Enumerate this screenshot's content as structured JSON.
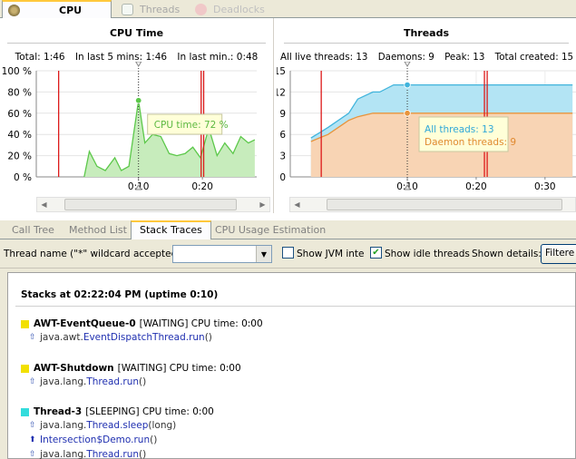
{
  "top_tabs": [
    {
      "label": "CPU",
      "icon": "cpu-icon",
      "active": true
    },
    {
      "label": "Threads",
      "icon": "threads-icon",
      "active": false
    },
    {
      "label": "Deadlocks",
      "icon": "deadlocks-icon",
      "active": false
    }
  ],
  "cpu_panel": {
    "title": "CPU Time",
    "stats": {
      "total": "Total: 1:46",
      "last5": "In last 5 mins: 1:46",
      "lastmin": "In last min.: 0:48"
    },
    "tooltip": "CPU time: 72 %"
  },
  "threads_panel": {
    "title": "Threads",
    "stats": {
      "live": "All live threads: 13",
      "daemons": "Daemons: 9",
      "peak": "Peak: 13",
      "created": "Total created: 15"
    },
    "tooltip_all": "All threads: 13",
    "tooltip_daemon": "Daemon threads: 9"
  },
  "chart_data": [
    {
      "type": "area",
      "title": "CPU Time",
      "xlabel": "",
      "ylabel": "",
      "yticks": [
        "100 %",
        "80 %",
        "60 %",
        "40 %",
        "20 %",
        "0 %"
      ],
      "xticks": [
        "0:10",
        "0:20"
      ],
      "ylim": [
        0,
        100
      ],
      "x_seconds": [
        1.5,
        2.3,
        3.5,
        4.8,
        6.3,
        7.3,
        8.5,
        10.0,
        11.0,
        12.2,
        13.5,
        14.8,
        16.0,
        17.3,
        18.5,
        19.7,
        21.0,
        22.3,
        23.5,
        24.8,
        26.0,
        27.2,
        28.2
      ],
      "values": [
        0,
        24,
        10,
        6,
        18,
        6,
        10,
        72,
        32,
        40,
        38,
        22,
        20,
        22,
        28,
        18,
        46,
        20,
        32,
        22,
        38,
        32,
        35
      ],
      "x_range": [
        -6,
        28.5
      ],
      "grid": true,
      "series_color": "#5cc84a",
      "fill_color": "#c7ecbc",
      "markers": {
        "red_lines_seconds": [
          -2.5,
          19.8,
          20.2
        ],
        "cursor_seconds": 10.0
      }
    },
    {
      "type": "area",
      "title": "Threads",
      "xlabel": "",
      "ylabel": "",
      "yticks": [
        "15",
        "12",
        "9",
        "6",
        "3",
        "0"
      ],
      "xticks": [
        "0:10",
        "0:20",
        "0:30"
      ],
      "ylim": [
        0,
        15
      ],
      "series": [
        {
          "name": "All threads",
          "x_seconds": [
            -4.0,
            -2.8,
            -1.5,
            1.5,
            2.8,
            5.0,
            6.0,
            8.0,
            10.0,
            34.0
          ],
          "values": [
            5.5,
            6.2,
            7.0,
            9.0,
            11.0,
            12.0,
            12.0,
            13.0,
            13.0,
            13.0
          ],
          "color": "#40b4dc",
          "fill": "#b3e4f4"
        },
        {
          "name": "Daemon threads",
          "x_seconds": [
            -4.0,
            -2.8,
            -1.5,
            1.5,
            2.8,
            5.0,
            34.0
          ],
          "values": [
            5.0,
            5.5,
            6.0,
            8.0,
            8.5,
            9.0,
            9.0
          ],
          "color": "#e8943c",
          "fill": "#f8d4b4"
        }
      ],
      "x_range": [
        -7,
        34.5
      ],
      "grid": true,
      "markers": {
        "red_lines_seconds": [
          -2.5,
          21.2,
          21.6
        ],
        "cursor_seconds": 10.0
      }
    }
  ],
  "lower_tabs": [
    "Call Tree",
    "Method List",
    "Stack Traces",
    "CPU Usage Estimation"
  ],
  "toolbar": {
    "name_label": "Thread name (\"*\" wildcard accepted):",
    "name_value": "",
    "show_jvm_label": "Show JVM inte",
    "show_jvm_checked": false,
    "show_idle_label": "Show idle threads",
    "show_idle_checked": true,
    "shown_details_label": "Shown details:",
    "filter_button": "Filtere"
  },
  "stacks": {
    "title": "Stacks at 02:22:04 PM (uptime 0:10)",
    "threads": [
      {
        "name": "AWT-EventQueue-0",
        "state": "[WAITING]",
        "cpu": "CPU time: 0:00",
        "color": "#f2e000",
        "frames": [
          {
            "pkg": "java.awt.",
            "cls": "EventDispatchThread.run",
            "suffix": "()",
            "user": false
          }
        ]
      },
      {
        "name": "AWT-Shutdown",
        "state": "[WAITING]",
        "cpu": "CPU time: 0:00",
        "color": "#f2e000",
        "frames": [
          {
            "pkg": "java.lang.",
            "cls": "Thread.run",
            "suffix": "()",
            "user": false
          }
        ]
      },
      {
        "name": "Thread-3",
        "state": "[SLEEPING]",
        "cpu": "CPU time: 0:00",
        "color": "#33dcdc",
        "frames": [
          {
            "pkg": "java.lang.",
            "cls": "Thread.sleep",
            "suffix": "(long)",
            "user": false
          },
          {
            "pkg": "",
            "cls": "Intersection$Demo.run",
            "suffix": "()",
            "user": true
          },
          {
            "pkg": "java.lang.",
            "cls": "Thread.run",
            "suffix": "()",
            "user": false
          }
        ]
      }
    ]
  }
}
